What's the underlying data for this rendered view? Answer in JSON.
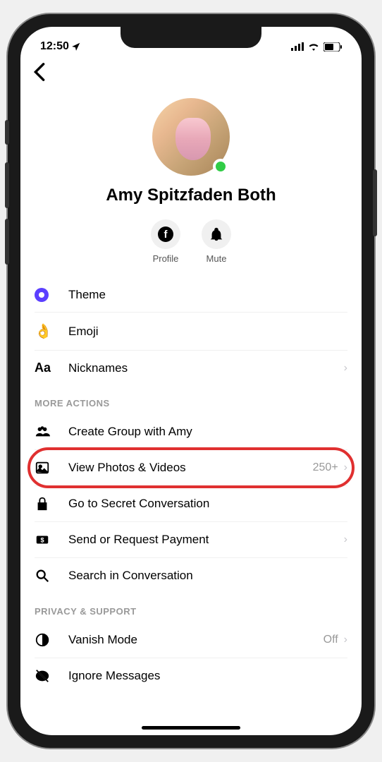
{
  "statusBar": {
    "time": "12:50"
  },
  "profile": {
    "name": "Amy Spitzfaden Both",
    "actions": {
      "profile": "Profile",
      "mute": "Mute"
    }
  },
  "customization": {
    "theme": "Theme",
    "emoji": "Emoji",
    "nicknames": "Nicknames"
  },
  "sections": {
    "moreActions": "MORE ACTIONS",
    "privacySupport": "PRIVACY & SUPPORT"
  },
  "moreActions": {
    "createGroup": "Create Group with Amy",
    "viewPhotos": "View Photos & Videos",
    "viewPhotosCount": "250+",
    "secretConversation": "Go to Secret Conversation",
    "sendPayment": "Send or Request Payment",
    "search": "Search in Conversation"
  },
  "privacy": {
    "vanishMode": "Vanish Mode",
    "vanishModeValue": "Off",
    "ignoreMessages": "Ignore Messages"
  }
}
